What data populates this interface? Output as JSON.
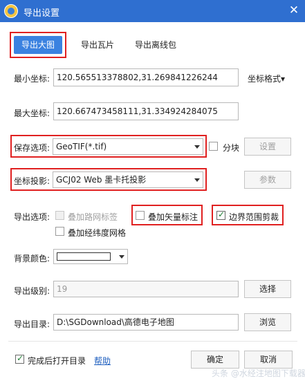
{
  "window": {
    "title": "导出设置",
    "close_glyph": "✕"
  },
  "tabs": [
    {
      "label": "导出大图",
      "active": true
    },
    {
      "label": "导出瓦片",
      "active": false
    },
    {
      "label": "导出离线包",
      "active": false
    }
  ],
  "coords": {
    "min_label": "最小坐标:",
    "min_value": "120.565513378802,31.269841226244",
    "max_label": "最大坐标:",
    "max_value": "120.667473458111,31.334924284075",
    "format_label": "坐标格式▾"
  },
  "save": {
    "label": "保存选项:",
    "value": "GeoTIF(*.tif)",
    "tile_label": "分块",
    "settings_button": "设置"
  },
  "projection": {
    "label": "坐标投影:",
    "value": "GCJ02 Web 墨卡托投影",
    "params_button": "参数"
  },
  "export_options": {
    "label": "导出选项:",
    "road_labels": "叠加路网标签",
    "vector_labels": "叠加矢量标注",
    "boundary_clip": "边界范围剪裁",
    "graticule": "叠加经纬度网格"
  },
  "background": {
    "label": "背景颜色:",
    "color": "#ffffff"
  },
  "level": {
    "label": "导出级别:",
    "value": "19",
    "select_button": "选择"
  },
  "directory": {
    "label": "导出目录:",
    "value": "D:\\SGDownload\\高德电子地图",
    "browse_button": "浏览"
  },
  "footer": {
    "open_after": "完成后打开目录",
    "help_link": "帮助",
    "ok_button": "确定",
    "cancel_button": "取消"
  },
  "watermark": "头条 @水经注地图下载器",
  "colors": {
    "titlebar": "#2f6fd0",
    "accent": "#3b82e0",
    "highlight": "#e02020"
  }
}
